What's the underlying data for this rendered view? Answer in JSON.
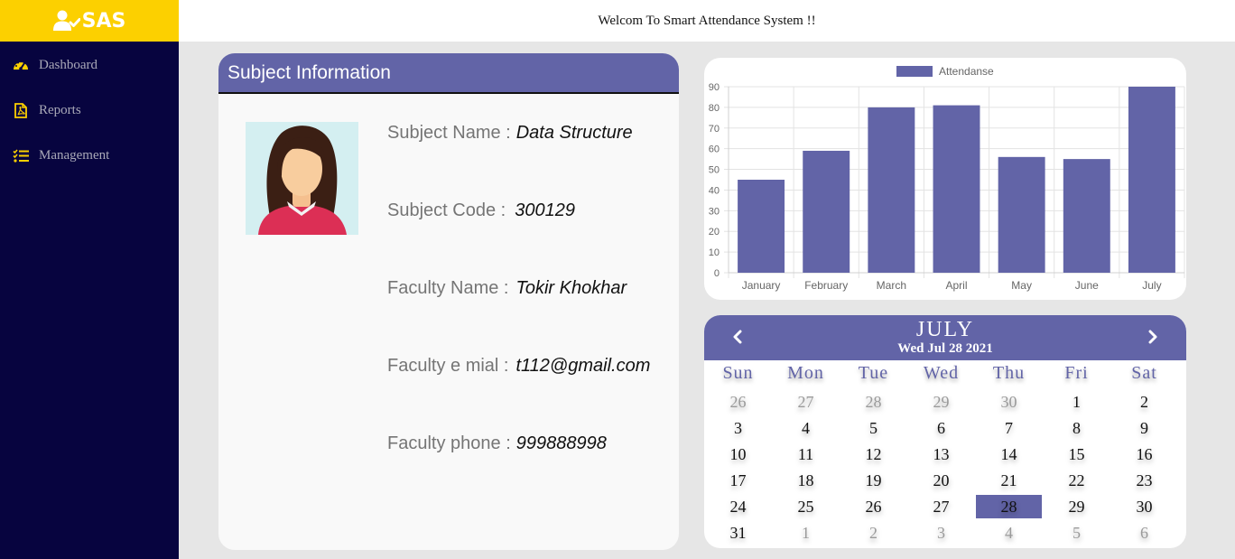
{
  "brand": {
    "name": "SAS",
    "bg_color": "#fcd000"
  },
  "topbar": {
    "welcome_text": "Welcom To Smart Attendance System !!"
  },
  "sidebar": {
    "items": [
      {
        "label": "Dashboard",
        "icon": "tachometer-icon"
      },
      {
        "label": "Reports",
        "icon": "pdf-file-icon"
      },
      {
        "label": "Management",
        "icon": "tasks-list-icon"
      }
    ]
  },
  "subject": {
    "title": "Subject Information",
    "rows": [
      {
        "label": "Subject Name :",
        "value": "Data Structure"
      },
      {
        "label": "Subject Code :",
        "value": "300129"
      },
      {
        "label": "Faculty Name :",
        "value": "Tokir Khokhar"
      },
      {
        "label": "Faculty e mial :",
        "value": "t112@gmail.com"
      },
      {
        "label": "Faculty phone :",
        "value": "999888998"
      }
    ]
  },
  "chart_data": {
    "type": "bar",
    "categories": [
      "January",
      "February",
      "March",
      "April",
      "May",
      "June",
      "July"
    ],
    "series": [
      {
        "name": "Attendanse",
        "values": [
          45,
          59,
          80,
          81,
          56,
          55,
          90
        ],
        "color": "#6264a7"
      }
    ],
    "ylim": [
      0,
      90
    ],
    "yticks": [
      0,
      10,
      20,
      30,
      40,
      50,
      60,
      70,
      80,
      90
    ],
    "grid": true,
    "legend_position": "top"
  },
  "calendar": {
    "month": "JULY",
    "current_date": "Wed Jul 28 2021",
    "weekdays": [
      "Sun",
      "Mon",
      "Tue",
      "Wed",
      "Thu",
      "Fri",
      "Sat"
    ],
    "weeks": [
      [
        {
          "d": "26",
          "m": true
        },
        {
          "d": "27",
          "m": true
        },
        {
          "d": "28",
          "m": true
        },
        {
          "d": "29",
          "m": true
        },
        {
          "d": "30",
          "m": true
        },
        {
          "d": "1"
        },
        {
          "d": "2"
        }
      ],
      [
        {
          "d": "3"
        },
        {
          "d": "4"
        },
        {
          "d": "5"
        },
        {
          "d": "6"
        },
        {
          "d": "7"
        },
        {
          "d": "8"
        },
        {
          "d": "9"
        }
      ],
      [
        {
          "d": "10"
        },
        {
          "d": "11"
        },
        {
          "d": "12"
        },
        {
          "d": "13"
        },
        {
          "d": "14"
        },
        {
          "d": "15"
        },
        {
          "d": "16"
        }
      ],
      [
        {
          "d": "17"
        },
        {
          "d": "18"
        },
        {
          "d": "19"
        },
        {
          "d": "20"
        },
        {
          "d": "21"
        },
        {
          "d": "22"
        },
        {
          "d": "23"
        }
      ],
      [
        {
          "d": "24"
        },
        {
          "d": "25"
        },
        {
          "d": "26"
        },
        {
          "d": "27"
        },
        {
          "d": "28",
          "s": true
        },
        {
          "d": "29"
        },
        {
          "d": "30"
        }
      ],
      [
        {
          "d": "31"
        },
        {
          "d": "1",
          "m": true
        },
        {
          "d": "2",
          "m": true
        },
        {
          "d": "3",
          "m": true
        },
        {
          "d": "4",
          "m": true
        },
        {
          "d": "5",
          "m": true
        },
        {
          "d": "6",
          "m": true
        }
      ]
    ],
    "accent_color": "#6264a7"
  }
}
